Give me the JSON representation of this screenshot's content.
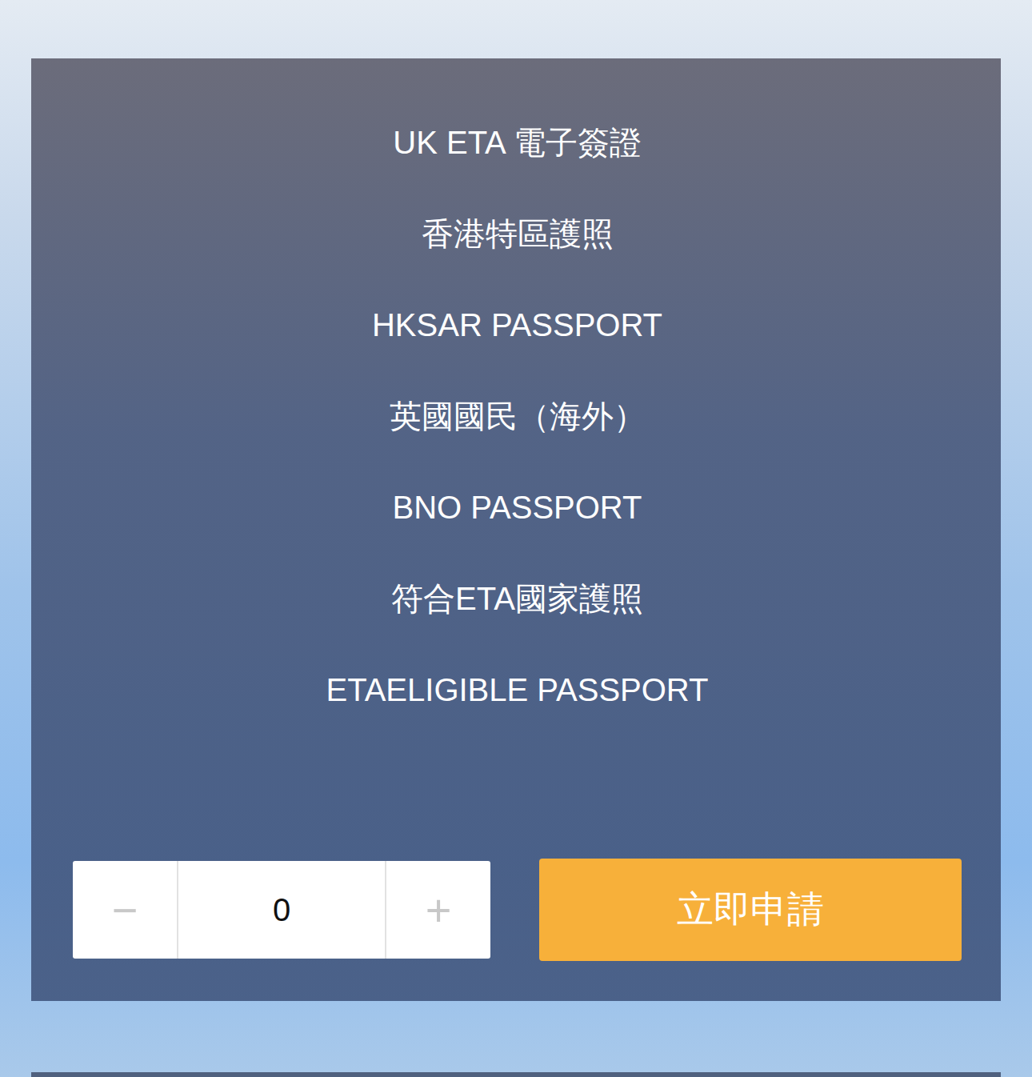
{
  "product": {
    "lines": [
      "UK ETA 電子簽證",
      "香港特區護照",
      "HKSAR PASSPORT",
      "英國國民（海外）",
      "BNO PASSPORT",
      "符合ETA國家護照",
      "ETAELIGIBLE PASSPORT"
    ]
  },
  "quantity": {
    "minus": "−",
    "value": "0",
    "plus": "+"
  },
  "apply_button": "立即申請"
}
